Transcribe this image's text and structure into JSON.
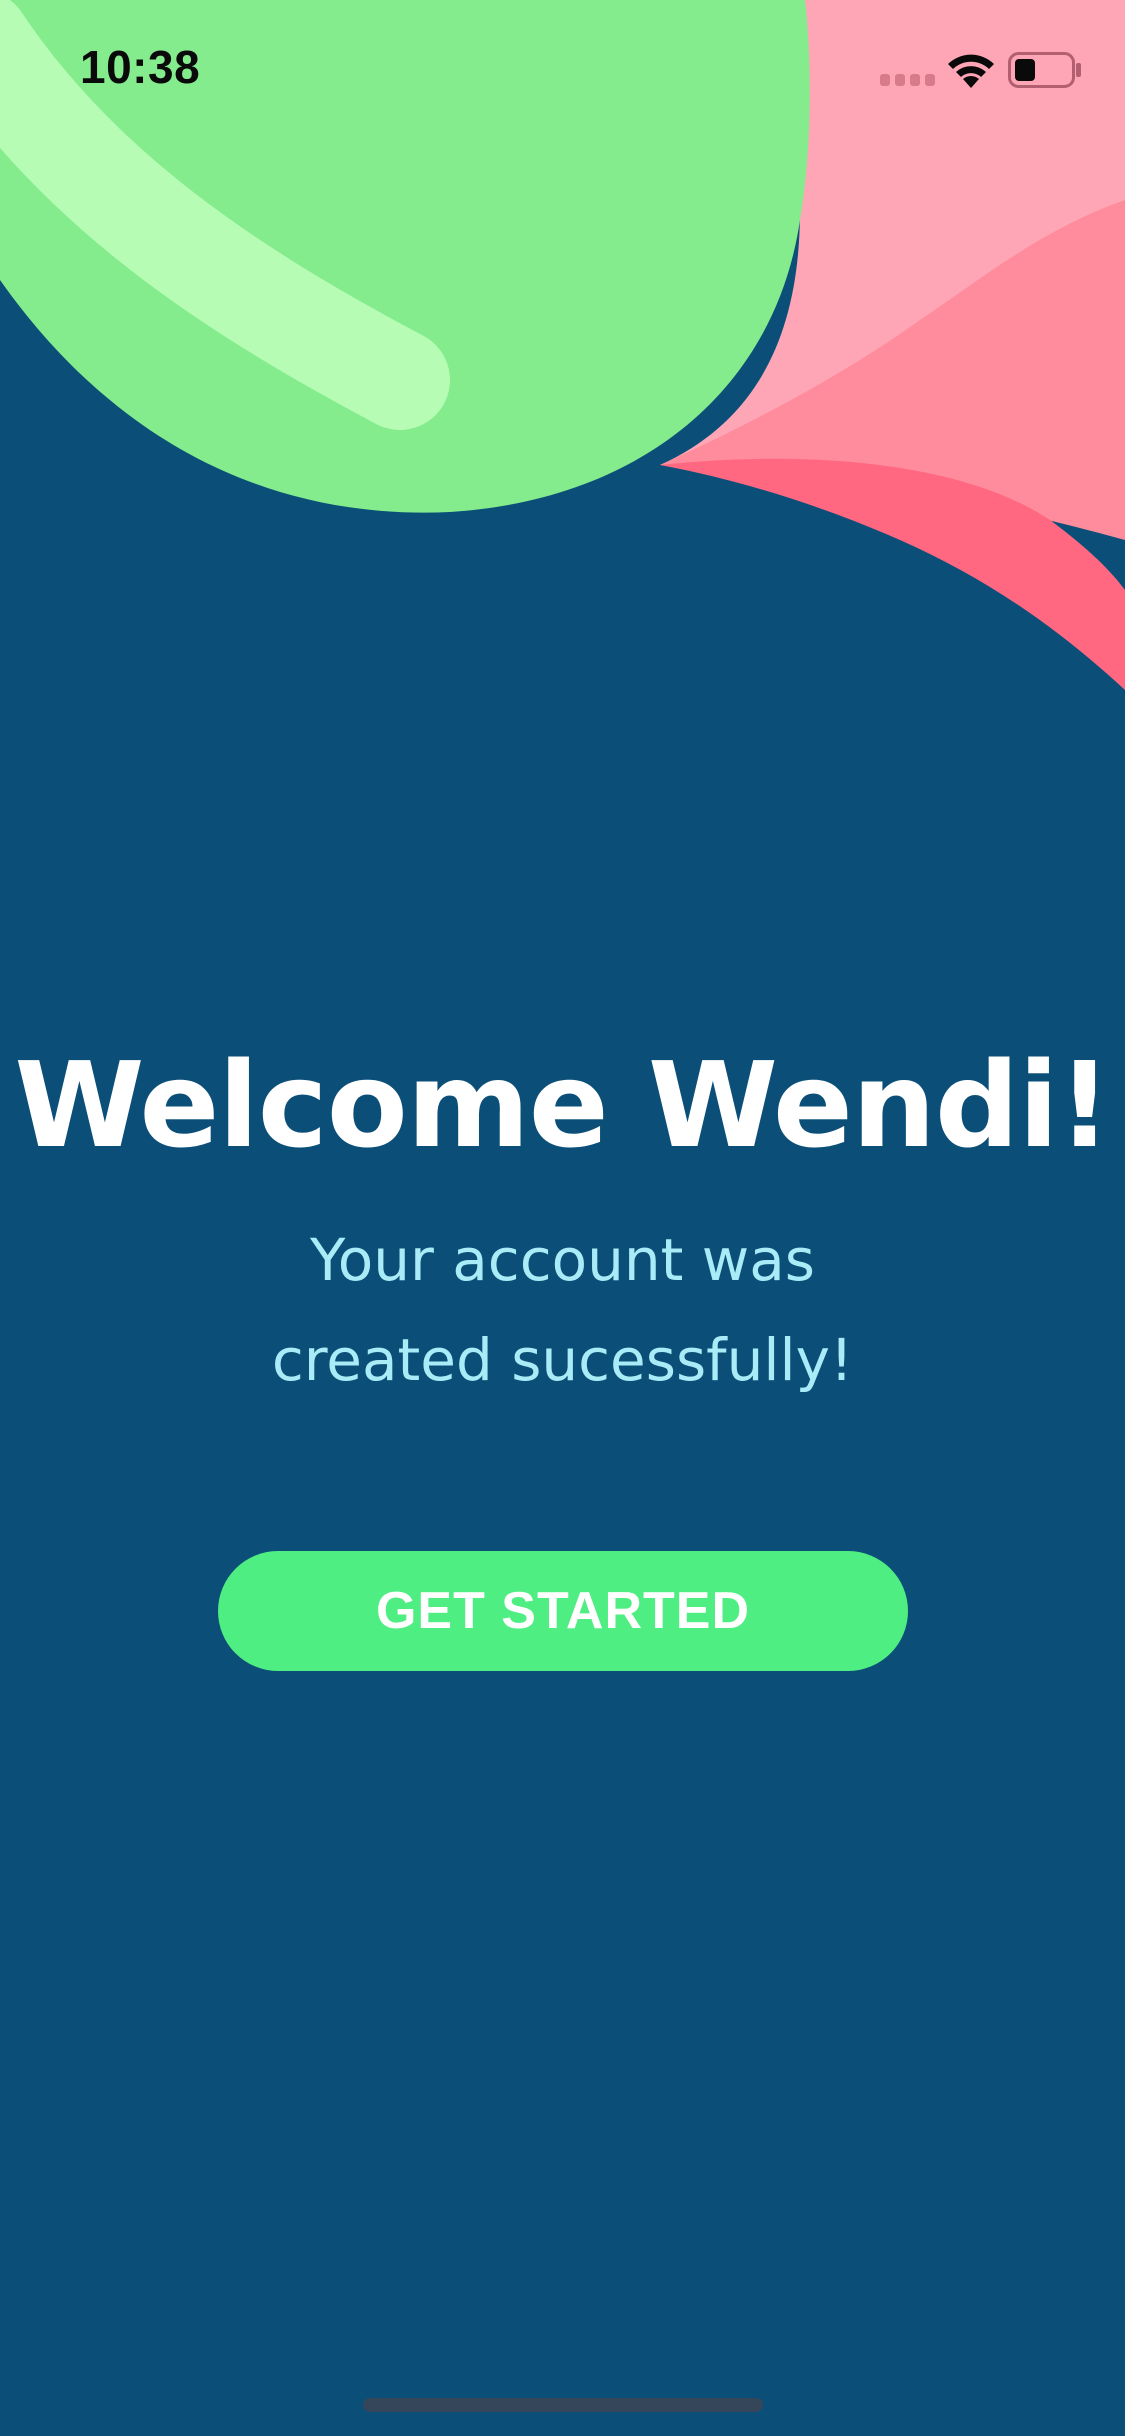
{
  "status_bar": {
    "time": "10:38",
    "signal_icon": "cellular-signal-icon",
    "wifi_icon": "wifi-icon",
    "battery_icon": "battery-icon",
    "battery_level": 0.3
  },
  "welcome": {
    "title": "Welcome Wendi!",
    "subtitle_line1": "Your account was",
    "subtitle_line2": "created sucessfully!"
  },
  "actions": {
    "get_started_label": "GET STARTED"
  },
  "colors": {
    "background": "#0b4f78",
    "green_blob": "#84ec8c",
    "green_highlight": "#b6fcb4",
    "pink_light": "#ffa6b6",
    "pink_mid": "#ff8c9c",
    "pink_dark": "#ff6880",
    "accent_button": "#4eee82",
    "title_text": "#ffffff",
    "subtitle_text": "#a9ecf7"
  }
}
